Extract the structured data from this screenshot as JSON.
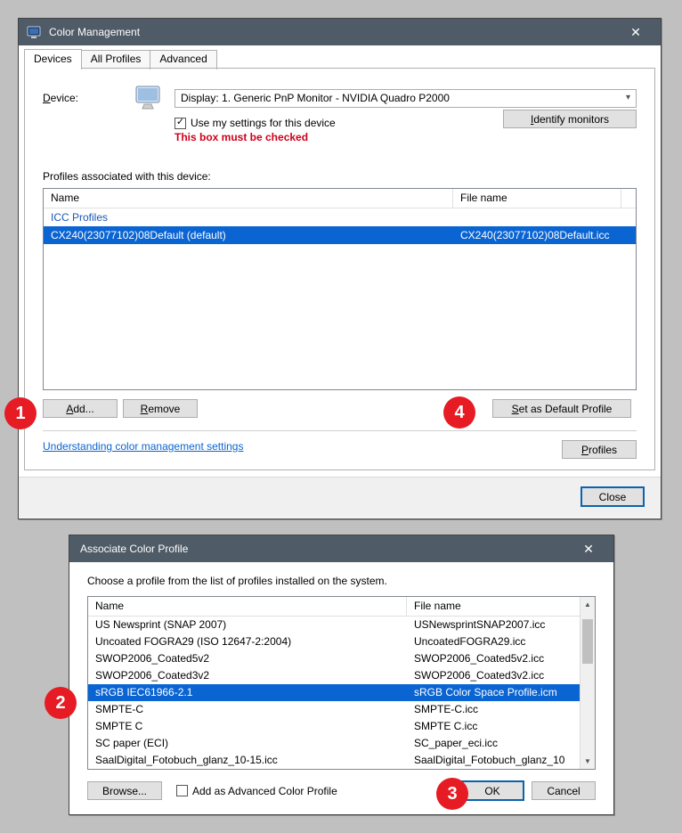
{
  "cm": {
    "title": "Color Management",
    "tabs": {
      "devices": "Devices",
      "all": "All Profiles",
      "adv": "Advanced"
    },
    "device_label_pre": "D",
    "device_label_post": "evice:",
    "device_value": "Display: 1. Generic PnP Monitor - NVIDIA Quadro P2000",
    "use_settings_pre": "U",
    "use_settings_post": "se my settings for this device",
    "annotation": "This box must be checked",
    "identify_pre": "I",
    "identify_post": "dentify monitors",
    "assoc_label": "Profiles associated with this device:",
    "table_head_name": "Name",
    "table_head_file": "File name",
    "group_label": "ICC Profiles",
    "row_name": "CX240(23077102)08Default (default)",
    "row_file": "CX240(23077102)08Default.icc",
    "add_pre": "A",
    "add_post": "dd...",
    "remove_pre": "R",
    "remove_post": "emove",
    "setdef_pre": "S",
    "setdef_post": "et as Default Profile",
    "link": "Understanding color management settings",
    "profiles_pre": "P",
    "profiles_post": "rofiles",
    "close": "Close"
  },
  "acp": {
    "title": "Associate Color Profile",
    "intro": "Choose a profile from the list of profiles installed on the system.",
    "head_name": "Name",
    "head_file": "File name",
    "rows": [
      {
        "n": "US Newsprint (SNAP 2007)",
        "f": "USNewsprintSNAP2007.icc"
      },
      {
        "n": "Uncoated FOGRA29 (ISO 12647-2:2004)",
        "f": "UncoatedFOGRA29.icc"
      },
      {
        "n": "SWOP2006_Coated5v2",
        "f": "SWOP2006_Coated5v2.icc"
      },
      {
        "n": "SWOP2006_Coated3v2",
        "f": "SWOP2006_Coated3v2.icc"
      },
      {
        "n": "sRGB IEC61966-2.1",
        "f": "sRGB Color Space Profile.icm",
        "sel": true
      },
      {
        "n": "SMPTE-C",
        "f": "SMPTE-C.icc"
      },
      {
        "n": "SMPTE C",
        "f": "SMPTE C.icc"
      },
      {
        "n": "SC paper (ECI)",
        "f": "SC_paper_eci.icc"
      },
      {
        "n": "SaalDigital_Fotobuch_glanz_10-15.icc",
        "f": "SaalDigital_Fotobuch_glanz_10"
      }
    ],
    "browse": "Browse...",
    "add_adv": "Add as Advanced Color Profile",
    "ok": "OK",
    "cancel": "Cancel"
  },
  "markers": {
    "m1": "1",
    "m2": "2",
    "m3": "3",
    "m4": "4"
  }
}
